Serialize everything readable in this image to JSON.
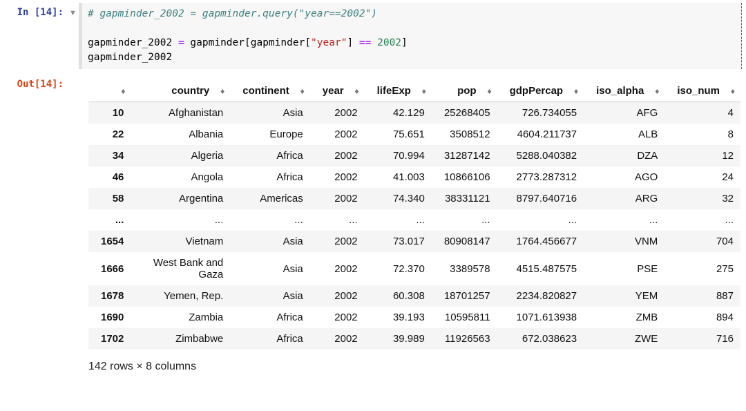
{
  "input_cell": {
    "prompt": "In [14]:",
    "code_tokens": [
      {
        "t": "# gapminder_2002 = gapminder.query(\"year==2002\")",
        "cls": "c-comment"
      },
      {
        "t": "\n\n",
        "cls": ""
      },
      {
        "t": "gapminder_2002",
        "cls": "c-var"
      },
      {
        "t": " ",
        "cls": ""
      },
      {
        "t": "=",
        "cls": "c-op"
      },
      {
        "t": " ",
        "cls": ""
      },
      {
        "t": "gapminder",
        "cls": "c-var"
      },
      {
        "t": "[",
        "cls": "c-punc"
      },
      {
        "t": "gapminder",
        "cls": "c-var"
      },
      {
        "t": "[",
        "cls": "c-punc"
      },
      {
        "t": "\"year\"",
        "cls": "c-str"
      },
      {
        "t": "]",
        "cls": "c-punc"
      },
      {
        "t": " ",
        "cls": ""
      },
      {
        "t": "==",
        "cls": "c-op"
      },
      {
        "t": " ",
        "cls": ""
      },
      {
        "t": "2002",
        "cls": "c-num"
      },
      {
        "t": "]",
        "cls": "c-punc"
      },
      {
        "t": "\n",
        "cls": ""
      },
      {
        "t": "gapminder_2002",
        "cls": "c-var"
      }
    ]
  },
  "output_cell": {
    "prompt": "Out[14]:",
    "columns": [
      "country",
      "continent",
      "year",
      "lifeExp",
      "pop",
      "gdpPercap",
      "iso_alpha",
      "iso_num"
    ],
    "rows": [
      {
        "idx": "10",
        "vals": [
          "Afghanistan",
          "Asia",
          "2002",
          "42.129",
          "25268405",
          "726.734055",
          "AFG",
          "4"
        ]
      },
      {
        "idx": "22",
        "vals": [
          "Albania",
          "Europe",
          "2002",
          "75.651",
          "3508512",
          "4604.211737",
          "ALB",
          "8"
        ]
      },
      {
        "idx": "34",
        "vals": [
          "Algeria",
          "Africa",
          "2002",
          "70.994",
          "31287142",
          "5288.040382",
          "DZA",
          "12"
        ]
      },
      {
        "idx": "46",
        "vals": [
          "Angola",
          "Africa",
          "2002",
          "41.003",
          "10866106",
          "2773.287312",
          "AGO",
          "24"
        ]
      },
      {
        "idx": "58",
        "vals": [
          "Argentina",
          "Americas",
          "2002",
          "74.340",
          "38331121",
          "8797.640716",
          "ARG",
          "32"
        ]
      },
      {
        "idx": "...",
        "vals": [
          "...",
          "...",
          "...",
          "...",
          "...",
          "...",
          "...",
          "..."
        ]
      },
      {
        "idx": "1654",
        "vals": [
          "Vietnam",
          "Asia",
          "2002",
          "73.017",
          "80908147",
          "1764.456677",
          "VNM",
          "704"
        ]
      },
      {
        "idx": "1666",
        "vals": [
          "West Bank and Gaza",
          "Asia",
          "2002",
          "72.370",
          "3389578",
          "4515.487575",
          "PSE",
          "275"
        ]
      },
      {
        "idx": "1678",
        "vals": [
          "Yemen, Rep.",
          "Asia",
          "2002",
          "60.308",
          "18701257",
          "2234.820827",
          "YEM",
          "887"
        ]
      },
      {
        "idx": "1690",
        "vals": [
          "Zambia",
          "Africa",
          "2002",
          "39.193",
          "10595811",
          "1071.613938",
          "ZMB",
          "894"
        ]
      },
      {
        "idx": "1702",
        "vals": [
          "Zimbabwe",
          "Africa",
          "2002",
          "39.989",
          "11926563",
          "672.038623",
          "ZWE",
          "716"
        ]
      }
    ],
    "footer": "142 rows × 8 columns"
  },
  "glyphs": {
    "collapser": "▼",
    "sort": "♦"
  }
}
